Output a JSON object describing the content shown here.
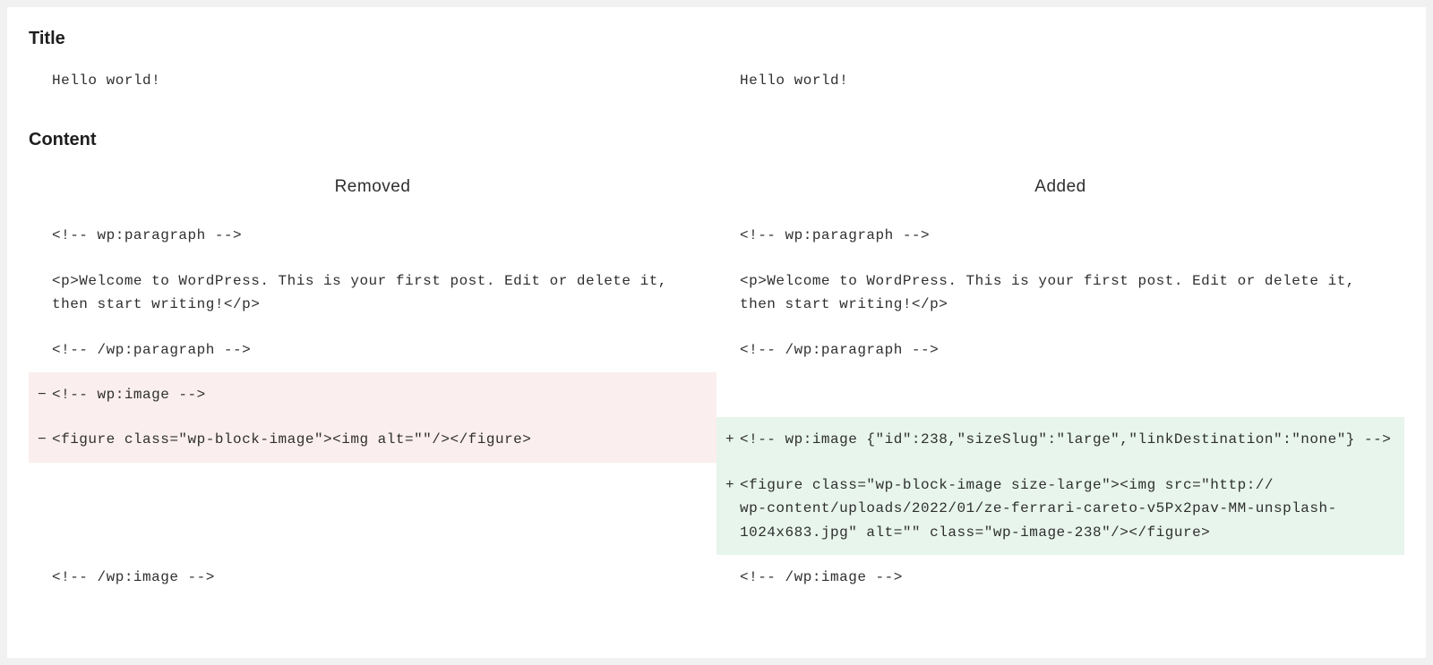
{
  "sections": {
    "title_heading": "Title",
    "content_heading": "Content"
  },
  "columns": {
    "left": "Removed",
    "right": "Added"
  },
  "title_diff": {
    "left": "Hello world!",
    "right": "Hello world!"
  },
  "content_diff": [
    {
      "type": "context",
      "left": "<!-- wp:paragraph -->",
      "right": "<!-- wp:paragraph -->"
    },
    {
      "type": "context",
      "left": "<p>Welcome to WordPress. This is your first post. Edit or delete it, then start writing!</p>",
      "right": "<p>Welcome to WordPress. This is your first post. Edit or delete it, then start writing!</p>"
    },
    {
      "type": "context",
      "left": "<!-- /wp:paragraph -->",
      "right": "<!-- /wp:paragraph -->"
    },
    {
      "type": "removed",
      "left": "<!-- wp:image -->",
      "right": ""
    },
    {
      "type": "change",
      "left": "<figure class=\"wp-block-image\"><img alt=\"\"/></figure>",
      "right": "<!-- wp:image {\"id\":238,\"sizeSlug\":\"large\",\"linkDestination\":\"none\"} -->"
    },
    {
      "type": "added",
      "left": "",
      "right": "<figure class=\"wp-block-image size-large\"><img src=\"http://              wp-content/uploads/2022/01/ze-ferrari-careto-v5Px2pav-MM-unsplash-1024x683.jpg\" alt=\"\" class=\"wp-image-238\"/></figure>"
    },
    {
      "type": "context",
      "left": "<!-- /wp:image -->",
      "right": "<!-- /wp:image -->"
    }
  ],
  "signs": {
    "minus": "−",
    "plus": "+"
  }
}
